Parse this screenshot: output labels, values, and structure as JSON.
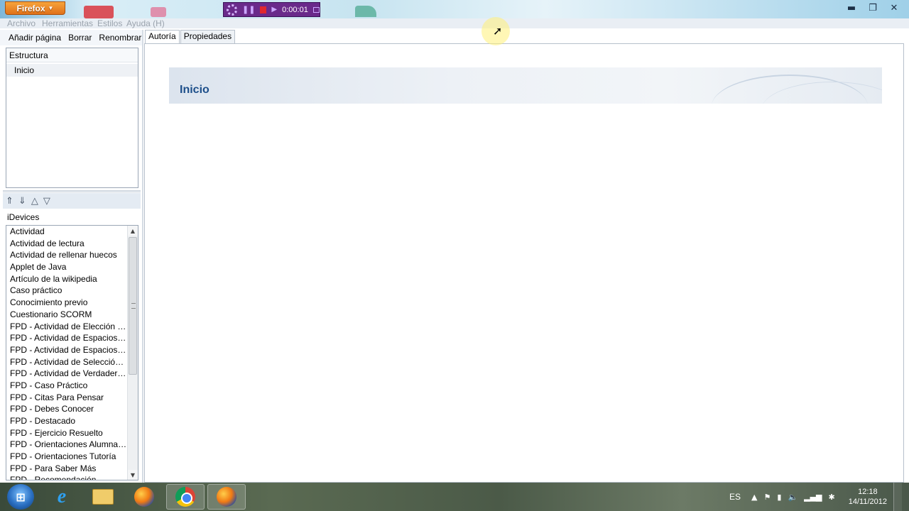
{
  "firefox_button": {
    "label": "Firefox"
  },
  "recorder": {
    "time": "0:00:01"
  },
  "menubar": {
    "items": [
      "Archivo",
      "Herramientas",
      "Estilos",
      "Ayuda (H)"
    ]
  },
  "left_toolbar": {
    "add_page": "Añadir página",
    "delete": "Borrar",
    "rename": "Renombrar"
  },
  "structure": {
    "header": "Estructura",
    "items": [
      "Inicio"
    ]
  },
  "idevices": {
    "label": "iDevices",
    "items": [
      "Actividad",
      "Actividad de lectura",
      "Actividad de rellenar huecos",
      "Applet de Java",
      "Artículo de la wikipedia",
      "Caso práctico",
      "Conocimiento previo",
      "Cuestionario SCORM",
      "FPD - Actividad de Elección Mú...",
      "FPD - Actividad de Espacios en ...",
      "FPD - Actividad de Espacios en ...",
      "FPD - Actividad de Selección M...",
      "FPD - Actividad de Verdadero/F...",
      "FPD - Caso Práctico",
      "FPD - Citas Para Pensar",
      "FPD - Debes Conocer",
      "FPD - Destacado",
      "FPD - Ejercicio Resuelto",
      "FPD - Orientaciones Alumnado",
      "FPD - Orientaciones Tutoría",
      "FPD - Para Saber Más",
      "FPD - Recomendación"
    ]
  },
  "tabs": [
    "Autoría",
    "Propiedades"
  ],
  "page": {
    "title": "Inicio"
  },
  "taskbar": {
    "lang": "ES",
    "time": "12:18",
    "date": "14/11/2012"
  }
}
